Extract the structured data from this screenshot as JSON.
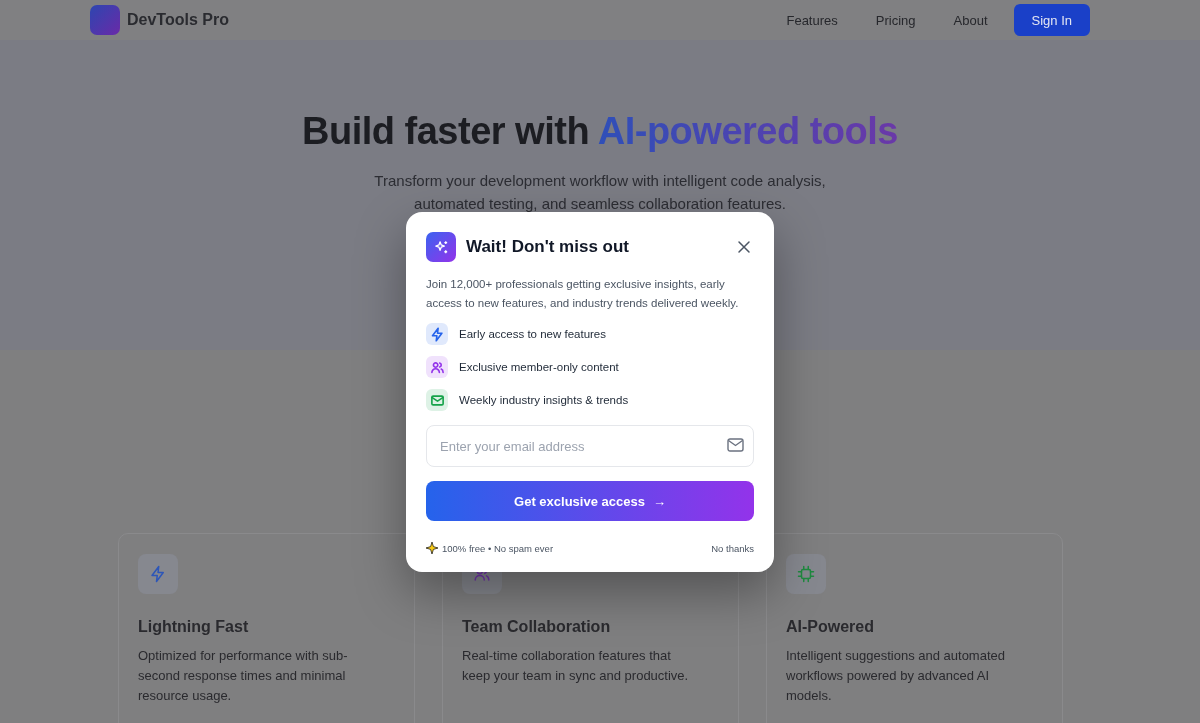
{
  "nav": {
    "brand": "DevTools Pro",
    "links": [
      "Features",
      "Pricing",
      "About"
    ],
    "cta": "Sign In"
  },
  "hero": {
    "title_lead": "Build faster with",
    "title_accent": "AI-powered tools",
    "subtitle_lines": [
      "Transform your development workflow with intelligent code analysis,",
      "automated testing, and seamless collaboration features."
    ]
  },
  "feature_cards": [
    {
      "kind": "bolt",
      "title": "Lightning Fast",
      "description": "Optimized for performance with sub-second response times and minimal resource usage."
    },
    {
      "kind": "users",
      "title": "Team Collaboration",
      "description": "Real-time collaboration features that keep your team in sync and productive."
    },
    {
      "kind": "chip",
      "title": "AI-Powered",
      "description": "Intelligent suggestions and automated workflows powered by advanced AI models."
    }
  ],
  "modal": {
    "title": "Wait! Don't miss out",
    "description": "Join 12,000+ professionals getting exclusive insights, early access to new features, and industry trends delivered weekly.",
    "benefits": [
      {
        "kind": "bolt",
        "color": "#2563eb",
        "label": "Early access to new features"
      },
      {
        "kind": "users",
        "color": "#9333ea",
        "label": "Exclusive member-only content"
      },
      {
        "kind": "mail",
        "color": "#16a34a",
        "label": "Weekly industry insights & trends"
      }
    ],
    "email": {
      "placeholder": "Enter your email address"
    },
    "submit": "Get exclusive access",
    "arrow": "→",
    "fine_print": "100% free • No spam ever",
    "dismiss": "No thanks"
  }
}
